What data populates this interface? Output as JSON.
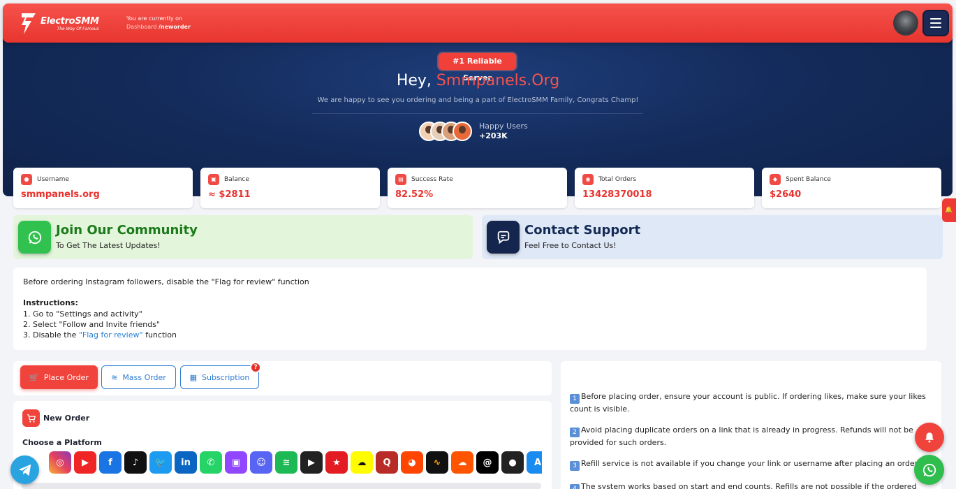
{
  "header": {
    "logo_name": "ElectroSMM",
    "logo_tagline": "The Way Of Famous",
    "crumb_line1": "You are currently on",
    "crumb_section": "Dashboard",
    "crumb_page": "/neworder"
  },
  "hero": {
    "badge": "#1 Reliable Server",
    "greeting_prefix": "Hey, ",
    "username": "Smmpanels.Org",
    "subtitle": "We are happy to see you ordering and being a part of ElectroSMM Family, Congrats Champ!",
    "users_label": "Happy Users",
    "users_count": "+203K"
  },
  "stats": [
    {
      "label": "Username",
      "value": "smmpanels.org",
      "icon": "user-icon"
    },
    {
      "label": "Balance",
      "value": "≈ $2811",
      "icon": "wallet-icon"
    },
    {
      "label": "Success Rate",
      "value": "82.52%",
      "icon": "chart-icon"
    },
    {
      "label": "Total Orders",
      "value": "13428370018",
      "icon": "orders-icon"
    },
    {
      "label": "Spent Balance",
      "value": "$2640",
      "icon": "coin-icon"
    }
  ],
  "community": {
    "title": "Join Our Community",
    "subtitle": "To Get The Latest Updates!"
  },
  "support": {
    "title": "Contact Support",
    "subtitle": "Feel Free to Contact Us!"
  },
  "notice": {
    "line1": "Before ordering Instagram followers, disable the \"Flag for review\" function",
    "heading": "Instructions:",
    "step1": "1. Go to \"Settings and activity\"",
    "step2": "2. Select \"Follow and Invite friends\"",
    "step3_pre": "3. Disable the ",
    "step3_link": "\"Flag for review\"",
    "step3_post": " function"
  },
  "tabs": {
    "place": "Place Order",
    "mass": "Mass Order",
    "subscription": "Subscription",
    "badge": "?"
  },
  "order": {
    "title": "New Order",
    "platform_label": "Choose a Platform"
  },
  "platforms": [
    "Instagram",
    "YouTube",
    "Facebook",
    "TikTok",
    "Twitter",
    "LinkedIn",
    "WhatsApp",
    "Twitch",
    "Discord",
    "Spotify",
    "Google Play",
    "Kinopoisk",
    "Snapchat",
    "Quora",
    "Reddit",
    "Audiomack",
    "SoundCloud",
    "Threads",
    "Apple",
    "App Store"
  ],
  "rules": [
    {
      "num": "1",
      "text": "Before placing order, ensure your account is public. If ordering likes, make sure your likes count is visible."
    },
    {
      "num": "2",
      "text": "Avoid placing duplicate orders on a link that is already in progress. Refunds will not be provided for such orders."
    },
    {
      "num": "3",
      "text": "Refill service is not available if you change your link or username after placing an order."
    },
    {
      "num": "4",
      "text": "The system works based on start and end counts. Refills are not possible if the ordered likes,"
    }
  ],
  "colors": {
    "accent": "#f0433c",
    "navy": "#142c5c",
    "link": "#2f7dd1",
    "whatsapp": "#2fbd4e",
    "telegram": "#2aa3e1"
  }
}
